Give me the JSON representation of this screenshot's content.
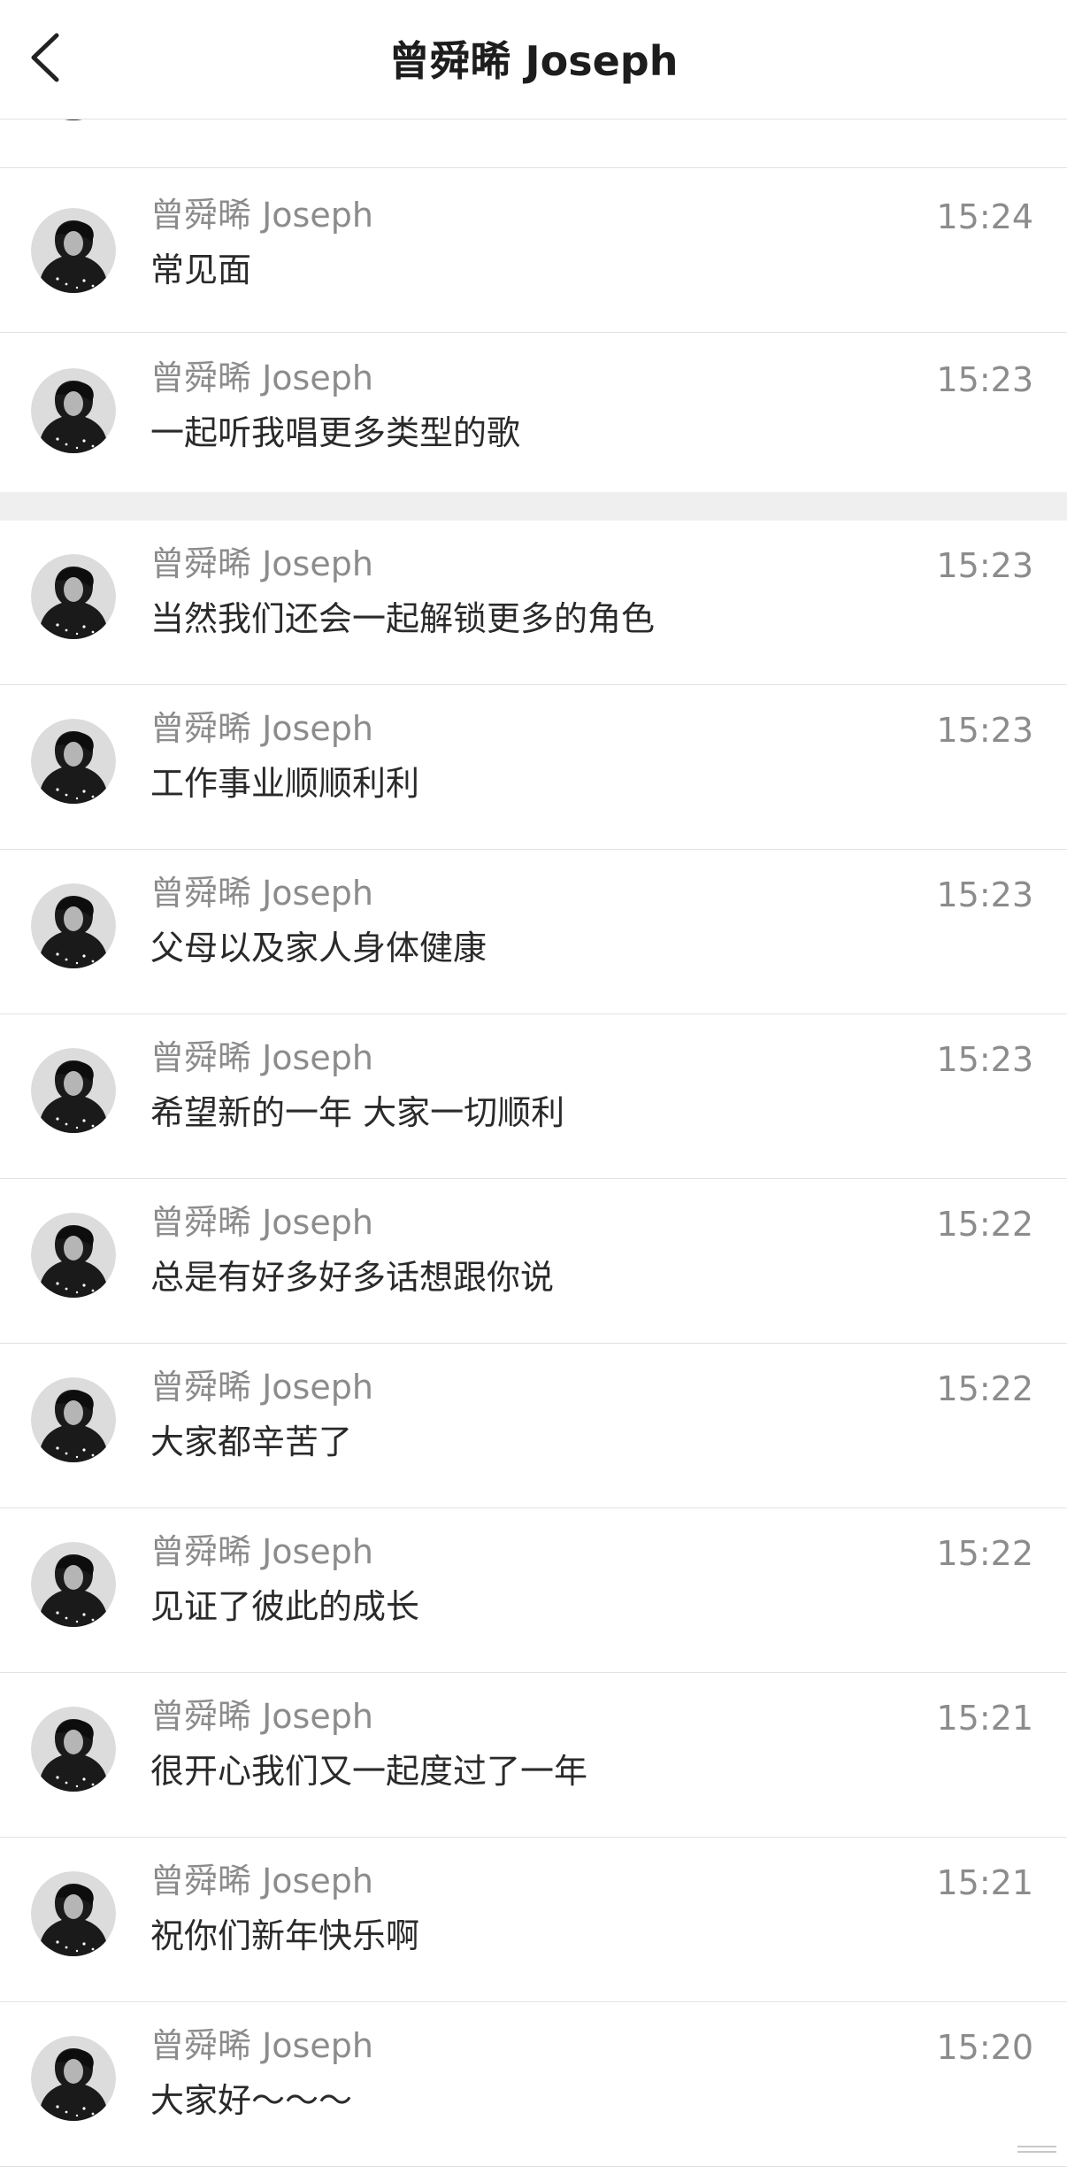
{
  "header": {
    "title": "曾舜晞 Joseph",
    "back_icon": "chevron-left-icon"
  },
  "messages": [
    {
      "sender": "曾舜晞 Joseph",
      "text": "常见面",
      "time": "15:24"
    },
    {
      "sender": "曾舜晞 Joseph",
      "text": "一起听我唱更多类型的歌",
      "time": "15:23"
    },
    {
      "sender": "曾舜晞 Joseph",
      "text": "当然我们还会一起解锁更多的角色",
      "time": "15:23"
    },
    {
      "sender": "曾舜晞 Joseph",
      "text": "工作事业顺顺利利",
      "time": "15:23"
    },
    {
      "sender": "曾舜晞 Joseph",
      "text": "父母以及家人身体健康",
      "time": "15:23"
    },
    {
      "sender": "曾舜晞 Joseph",
      "text": "希望新的一年 大家一切顺利",
      "time": "15:23"
    },
    {
      "sender": "曾舜晞 Joseph",
      "text": "总是有好多好多话想跟你说",
      "time": "15:22"
    },
    {
      "sender": "曾舜晞 Joseph",
      "text": "大家都辛苦了",
      "time": "15:22"
    },
    {
      "sender": "曾舜晞 Joseph",
      "text": "见证了彼此的成长",
      "time": "15:22"
    },
    {
      "sender": "曾舜晞 Joseph",
      "text": "很开心我们又一起度过了一年",
      "time": "15:21"
    },
    {
      "sender": "曾舜晞 Joseph",
      "text": "祝你们新年快乐啊",
      "time": "15:21"
    },
    {
      "sender": "曾舜晞 Joseph",
      "text": "大家好～～～",
      "time": "15:20"
    }
  ],
  "colors": {
    "background": "#ffffff",
    "divider": "#e2e2e2",
    "section_gap": "#efefef",
    "meta_text": "#8c8c8c",
    "body_text": "#2a2a2a",
    "title_text": "#1d1d1d"
  }
}
